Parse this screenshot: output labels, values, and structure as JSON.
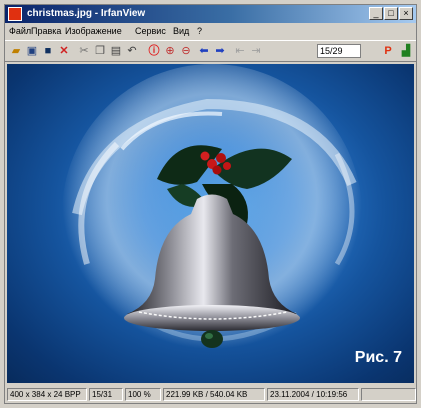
{
  "window": {
    "title": "christmas.jpg - IrfanView"
  },
  "menu": [
    "Файл",
    "Правка",
    "Изображение",
    "Сервис",
    "Вид",
    "?"
  ],
  "toolbar": {
    "counter": "15/29"
  },
  "icons": [
    "open-icon",
    "slideshow-icon",
    "save-icon",
    "delete-icon",
    "cut-icon",
    "copy-icon",
    "paste-icon",
    "undo-icon",
    "info-icon",
    "zoom-in-icon",
    "zoom-out-icon",
    "previous-icon",
    "next-icon",
    "first-icon",
    "last-icon",
    "counter-field",
    "paint-icon",
    "exit-icon"
  ],
  "status": {
    "dims": "400 x 384 x 24 BPP",
    "index": "15/31",
    "zoom": "100 %",
    "size": "221.99 KB / 540.04 KB",
    "date": "23.11.2004 / 10:19:56"
  },
  "caption": "Рис. 7"
}
